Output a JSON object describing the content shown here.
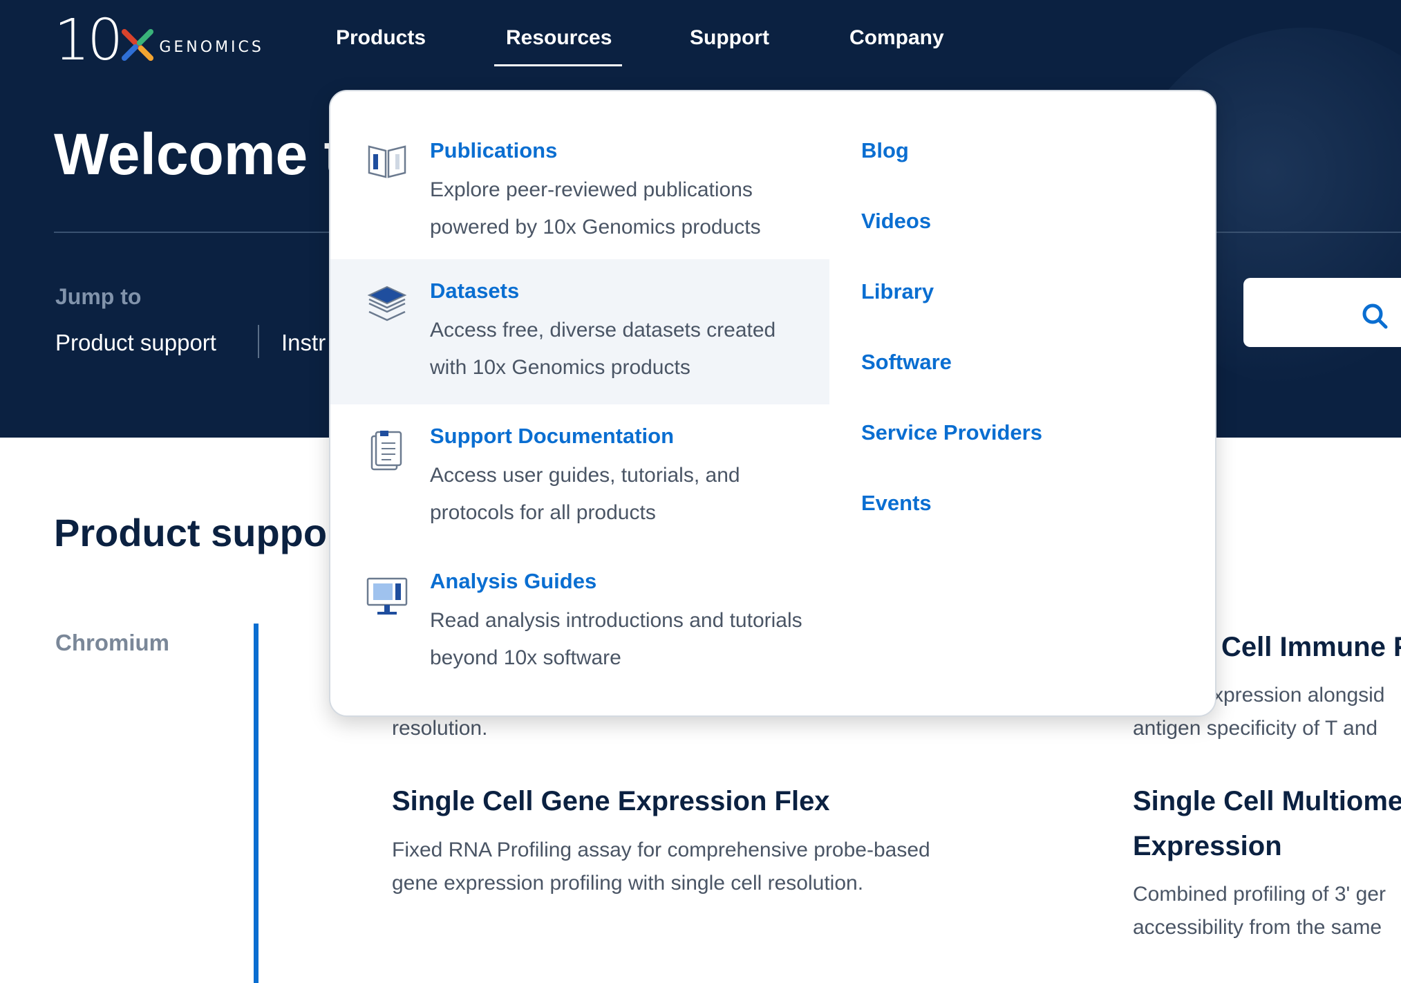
{
  "brand": {
    "logo_number": "10",
    "logo_word": "GENOMICS"
  },
  "nav": {
    "items": [
      "Products",
      "Resources",
      "Support",
      "Company"
    ],
    "active": "Resources"
  },
  "hero": {
    "title": "Welcome to",
    "jump_label": "Jump to",
    "jump_links": [
      "Product support",
      "Instr"
    ]
  },
  "search": {
    "icon": "search-icon"
  },
  "main": {
    "section_title": "Product support",
    "category": "Chromium",
    "products": [
      {
        "title": "",
        "desc_lines": [
          "resolution."
        ]
      },
      {
        "title": "Single Cell Gene Expression Flex",
        "desc_lines": [
          "Fixed RNA Profiling assay for comprehensive probe-based",
          "gene expression profiling with single cell resolution."
        ]
      },
      {
        "title": "Cell Immune F",
        "desc_lines": [
          "xpression alongsid",
          "antigen specificity of T and"
        ]
      },
      {
        "title": "Single Cell Multiome",
        "title_line2": "Expression",
        "desc_lines": [
          "Combined profiling of 3' ger",
          "accessibility from the same"
        ]
      }
    ]
  },
  "dropdown": {
    "items": [
      {
        "icon": "book-icon",
        "title": "Publications",
        "desc": "Explore peer-reviewed publications powered by 10x Genomics products"
      },
      {
        "icon": "layers-icon",
        "title": "Datasets",
        "desc": "Access free, diverse datasets created with 10x Genomics products",
        "active": true
      },
      {
        "icon": "document-icon",
        "title": "Support Documentation",
        "desc": "Access user guides, tutorials, and protocols for all products"
      },
      {
        "icon": "monitor-icon",
        "title": "Analysis Guides",
        "desc": "Read analysis introductions and tutorials beyond 10x software"
      }
    ],
    "links": [
      "Blog",
      "Videos",
      "Library",
      "Software",
      "Service Providers",
      "Events"
    ]
  },
  "colors": {
    "navy": "#0b2141",
    "link_blue": "#0a6ed1",
    "hover_bg": "#f2f5f9"
  }
}
